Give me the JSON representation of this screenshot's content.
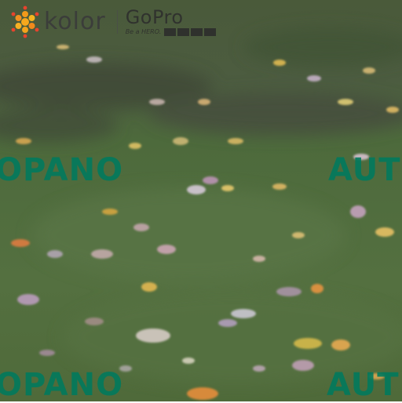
{
  "branding": {
    "kolor_name": "kolor",
    "gopro_name": "GoPro",
    "gopro_tagline": "Be a HERO."
  },
  "watermarks": {
    "left_text": "OPANO",
    "right_text": "AUT"
  },
  "colors": {
    "grass": "#4f6a3c",
    "watermark": "#007a5e",
    "kolor_orange": "#f29a1a",
    "kolor_red": "#e8432d"
  },
  "icons": {
    "kolor_logo": "kolor-flower-icon"
  }
}
